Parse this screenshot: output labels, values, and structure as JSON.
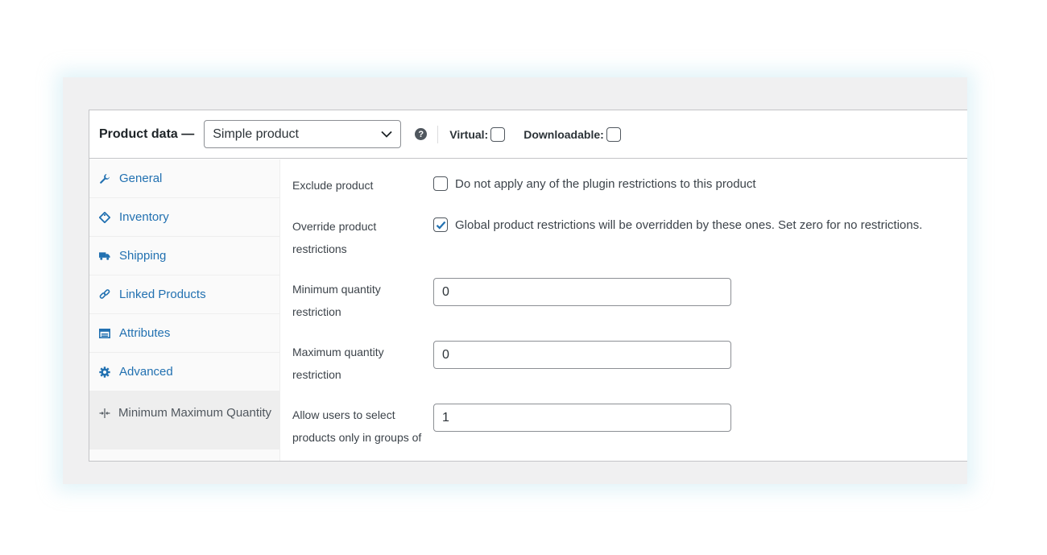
{
  "header": {
    "title": "Product data —",
    "product_type": "Simple product",
    "help": "?",
    "virtual_label": "Virtual:",
    "downloadable_label": "Downloadable:"
  },
  "tabs": [
    {
      "label": "General",
      "icon": "wrench-icon"
    },
    {
      "label": "Inventory",
      "icon": "tag-icon"
    },
    {
      "label": "Shipping",
      "icon": "truck-icon"
    },
    {
      "label": "Linked Products",
      "icon": "link-icon"
    },
    {
      "label": "Attributes",
      "icon": "list-icon"
    },
    {
      "label": "Advanced",
      "icon": "gear-icon"
    },
    {
      "label": "Minimum Maximum Quantity",
      "icon": "min-max-icon",
      "active": true
    }
  ],
  "fields": {
    "exclude": {
      "label": "Exclude product",
      "description": "Do not apply any of the plugin restrictions to this product",
      "checked": false
    },
    "override": {
      "label": "Override product restrictions",
      "description": "Global product restrictions will be overridden by these ones. Set zero for no restrictions.",
      "checked": true
    },
    "min_qty": {
      "label": "Minimum quantity restriction",
      "value": "0"
    },
    "max_qty": {
      "label": "Maximum quantity restriction",
      "value": "0"
    },
    "group_of": {
      "label": "Allow users to select products only in groups of",
      "value": "1"
    }
  },
  "colors": {
    "link_blue": "#2271b1",
    "check_blue": "#2271b1",
    "frame_bg": "#f0f0f1",
    "border": "#c3c4c7"
  }
}
